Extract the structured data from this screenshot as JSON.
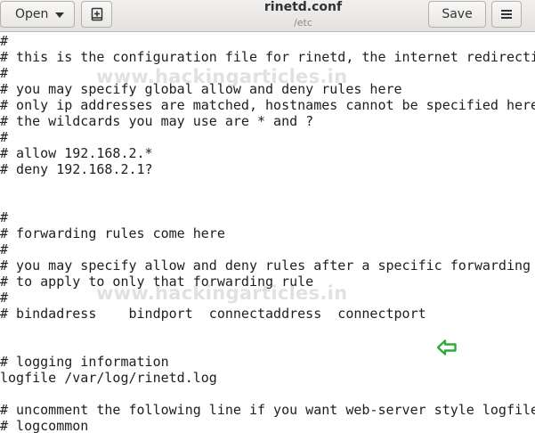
{
  "header": {
    "open_label": "Open",
    "title": "rinetd.conf",
    "subtitle": "/etc",
    "save_label": "Save"
  },
  "icons": {
    "open_dropdown": "chevron-down-icon",
    "new_tab": "new-document-icon",
    "menu": "hamburger-menu-icon",
    "annotation": "arrow-left-icon"
  },
  "colors": {
    "annotation_arrow": "#2eaa3c"
  },
  "watermark": "www.hackingarticles.in",
  "lines": [
    "#",
    "# this is the configuration file for rinetd, the internet redirection server",
    "#",
    "# you may specify global allow and deny rules here",
    "# only ip addresses are matched, hostnames cannot be specified here",
    "# the wildcards you may use are * and ?",
    "#",
    "# allow 192.168.2.*",
    "# deny 192.168.2.1?",
    "",
    "",
    "#",
    "# forwarding rules come here",
    "#",
    "# you may specify allow and deny rules after a specific forwarding rule",
    "# to apply to only that forwarding rule",
    "#",
    "# bindadress    bindport  connectaddress  connectport",
    "",
    "",
    "# logging information",
    "logfile /var/log/rinetd.log",
    "",
    "# uncomment the following line if you want web-server style logfile format",
    "# logcommon"
  ]
}
